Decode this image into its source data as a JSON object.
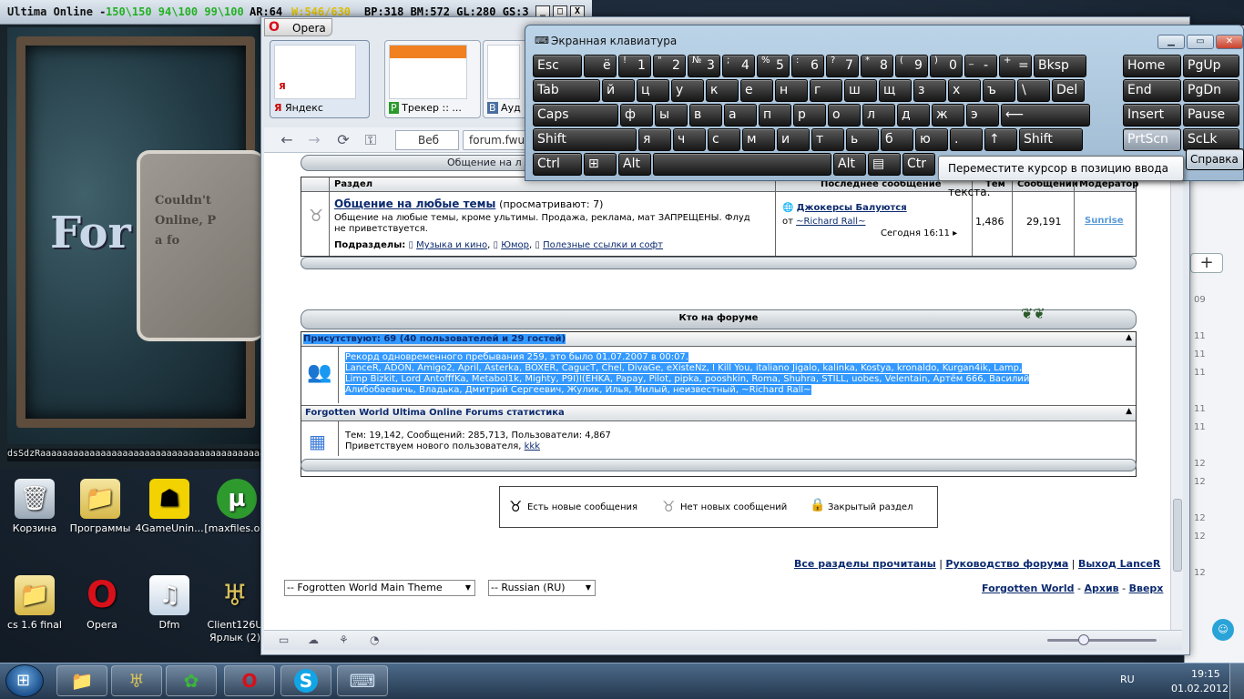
{
  "uo": {
    "title": "Ultima Online -",
    "stats_green": "150\\150 94\\100 99\\100",
    "ar": "AR:64",
    "w": "W:546/630",
    "bp": "BP:318 BM:572 GL:280 GS:3",
    "ctrl_min": "_",
    "ctrl_max": "□",
    "ctrl_close": "X",
    "panel_text": [
      "Couldn't",
      "Online, P",
      "a fo"
    ],
    "big_text": "For",
    "chat_line": "dsSdzRaaaaaaaaaaaaaaaaaaaaaaaaaaaaaaaaaaaaaaaaaaaaaaaaaaa"
  },
  "desktop": {
    "icons": [
      {
        "label": "Корзина",
        "icon": "recycle-bin-icon"
      },
      {
        "label": "Программы",
        "icon": "folder-icon"
      },
      {
        "label": "4GameUnin...",
        "icon": "4game-icon"
      },
      {
        "label": "[maxfiles.o...",
        "icon": "utorrent-icon"
      },
      {
        "label": "cs 1.6 final",
        "icon": "folder-icon"
      },
      {
        "label": "Opera",
        "icon": "opera-icon"
      },
      {
        "label": "Dfm",
        "icon": "media-file-icon"
      },
      {
        "label": "Client126U",
        "label2": "Ярлык (2)",
        "icon": "uo-client-icon"
      }
    ]
  },
  "opera": {
    "menu_label": "Opera",
    "tabs": [
      {
        "name": "Яндекс"
      },
      {
        "name": "Трекер :: ..."
      },
      {
        "name": "Ауд"
      }
    ],
    "search_engine": "Веб",
    "address": "forum.fwuo"
  },
  "forum": {
    "section_header_partial": "Общение на л",
    "columns": {
      "section": "Раздел",
      "last_post": "Последнее сообщение",
      "topics": "Тем",
      "posts": "Сообщений",
      "moderator": "Модератор"
    },
    "forum_row": {
      "title": "Общение на любые темы",
      "viewing": "(просматривают: 7)",
      "desc": "Общение на любые темы, кроме ультимы. Продажа, реклама, мат ЗАПРЕЩЕНЫ. Флуд не приветствуется.",
      "subforums_label": "Подразделы:",
      "subforums": [
        "Музыка и кино",
        "Юмор",
        "Полезные ссылки и софт"
      ],
      "last_title": "Джокерсы Балуются",
      "last_from": "от",
      "last_user": "~Richard Rall~",
      "last_time": "Сегодня 16:11",
      "topics": "1,486",
      "posts": "29,191",
      "moderator": "Sunrise"
    },
    "who_title": "Кто на форуме",
    "present": "Присутствуют: 69 (40 пользователей и 29 гостей)",
    "record": "Рекорд одновременного пребывания 259, это было 01.07.2007 в 00:07.",
    "users_line1": "LanceR, ADON, Amigo2, April, Asterka, BOXER, CagucT, Chel, DivaGe, eXisteNz, I Kill You, italiano Jigalo, kalinka, Kostya, kronaldo, Kurgan4ik, Lamp,",
    "users_line2": "Limp Bizkit, Lord AntofffKa, Metabol1k, Mighty, P9I)I(EHKA, Papay, Pilot, pipka, pooshkin, Roma, Shuhra, STILL, uobes, Velentain, Артём 666, Василий",
    "users_line3": "Алибобаевичь, Владька, Дмитрий Сергеевич, Жулик, Илья, Милый, неизвестный, ~Richard Rall~",
    "stats_title": "Forgotten World Ultima Online Forums статистика",
    "stats_line": "Тем: 19,142, Сообщений: 285,713, Пользователи: 4,867",
    "welcome": "Приветствуем нового пользователя,",
    "welcome_user": "kkk",
    "legend": [
      "Есть новые сообщения",
      "Нет новых сообщений",
      "Закрытый раздел"
    ],
    "footer_links": [
      "Все разделы прочитаны",
      "Руководство форума",
      "Выход LanceR"
    ],
    "theme_select": "-- Fogrotten World Main Theme",
    "lang_select": "-- Russian (RU)",
    "bottom_links": [
      "Forgotten World",
      "Архив",
      "Вверх"
    ]
  },
  "keyboard": {
    "title": "Экранная клавиатура",
    "tooltip": "Переместите курсор в позицию ввода текста.",
    "row1": [
      {
        "m": "Esc"
      },
      {
        "s": "",
        "m": "ё"
      },
      {
        "s": "!",
        "m": "1"
      },
      {
        "s": "\"",
        "m": "2"
      },
      {
        "s": "№",
        "m": "3"
      },
      {
        "s": ";",
        "m": "4"
      },
      {
        "s": "%",
        "m": "5"
      },
      {
        "s": ":",
        "m": "6"
      },
      {
        "s": "?",
        "m": "7"
      },
      {
        "s": "*",
        "m": "8"
      },
      {
        "s": "(",
        "m": "9"
      },
      {
        "s": ")",
        "m": "0"
      },
      {
        "s": "_",
        "m": "-"
      },
      {
        "s": "+",
        "m": "="
      },
      {
        "m": "Bksp"
      },
      {
        "m": "Home"
      },
      {
        "m": "PgUp"
      }
    ],
    "row2": [
      "Tab",
      "й",
      "ц",
      "у",
      "к",
      "е",
      "н",
      "г",
      "ш",
      "щ",
      "з",
      "х",
      "ъ",
      "\\",
      "Del",
      "End",
      "PgDn"
    ],
    "row3": [
      "Caps",
      "ф",
      "ы",
      "в",
      "а",
      "п",
      "р",
      "о",
      "л",
      "д",
      "ж",
      "э",
      "⟵",
      "Insert",
      "Pause"
    ],
    "row4": [
      "Shift",
      "я",
      "ч",
      "с",
      "м",
      "и",
      "т",
      "ь",
      "б",
      "ю",
      ".",
      "↑",
      "Shift",
      "PrtScn",
      "ScLk"
    ],
    "row5": [
      "Ctrl",
      "⊞",
      "Alt",
      "",
      "Alt",
      "▤",
      "Ctr"
    ],
    "help": "Справка"
  },
  "taskbar": {
    "lang": "RU",
    "time": "19:15",
    "date": "01.02.2012"
  },
  "right_window": {
    "times": [
      "09",
      "11",
      "11",
      "11",
      "11",
      "11",
      "12",
      "12",
      "12",
      "12",
      "12"
    ]
  }
}
